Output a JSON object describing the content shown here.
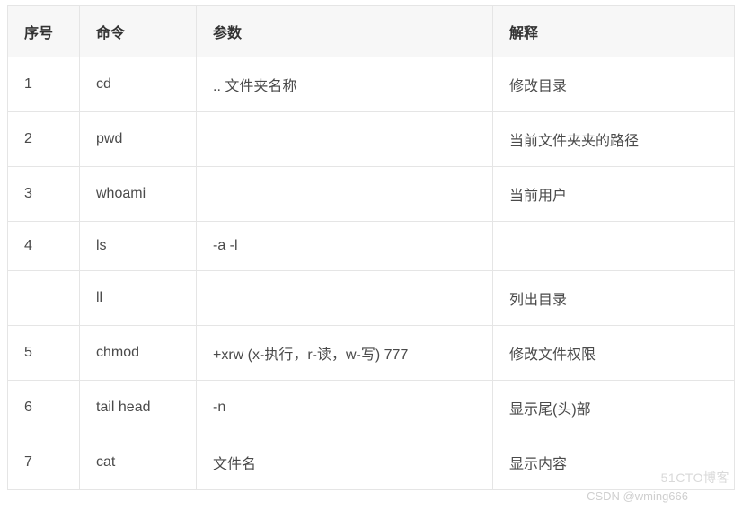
{
  "table": {
    "headers": {
      "num": "序号",
      "cmd": "命令",
      "param": "参数",
      "desc": "解释"
    },
    "rows": [
      {
        "num": "1",
        "cmd": "cd",
        "param": ".. 文件夹名称",
        "desc": "修改目录"
      },
      {
        "num": "2",
        "cmd": "pwd",
        "param": "",
        "desc": "当前文件夹夹的路径"
      },
      {
        "num": "3",
        "cmd": "whoami",
        "param": "",
        "desc": "当前用户"
      },
      {
        "num": "4",
        "cmd": "ls",
        "param": "-a -l",
        "desc": ""
      },
      {
        "num": "",
        "cmd": "ll",
        "param": "",
        "desc": "列出目录"
      },
      {
        "num": "5",
        "cmd": "chmod",
        "param": "+xrw (x-执行，r-读，w-写) 777",
        "desc": "修改文件权限"
      },
      {
        "num": "6",
        "cmd": "tail head",
        "param": "-n",
        "desc": "显示尾(头)部"
      },
      {
        "num": "7",
        "cmd": "cat",
        "param": "文件名",
        "desc": "显示内容"
      }
    ]
  },
  "watermarks": {
    "w1": "51CTO博客",
    "w2": "CSDN @wming666"
  }
}
